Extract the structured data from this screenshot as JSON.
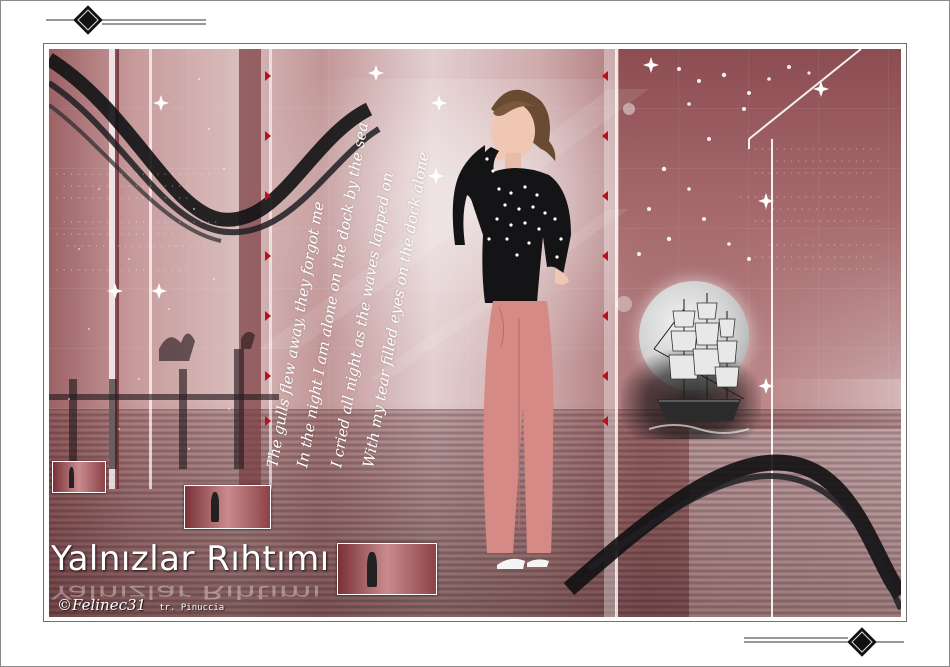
{
  "title": "Yalnızlar Rıhtımı",
  "credits": {
    "author": "©Felinec31",
    "translator": "tr. Pinuccia"
  },
  "poem_lines": [
    "The gulls flew away, they forgot me",
    "In the night I am alone on the dock by the sea",
    "I cried all night as the waves lapped on",
    "With my tear filled eyes on the dock alone"
  ],
  "colors": {
    "background": "#c79a9b",
    "accent_rose": "#d58a86",
    "dark_band": "#1c1c1e",
    "frame": "#6f6f6f"
  },
  "icons": [
    "diamond-ornament",
    "sparkle-star",
    "red-arrow-marker",
    "ship",
    "moon",
    "seagull"
  ]
}
